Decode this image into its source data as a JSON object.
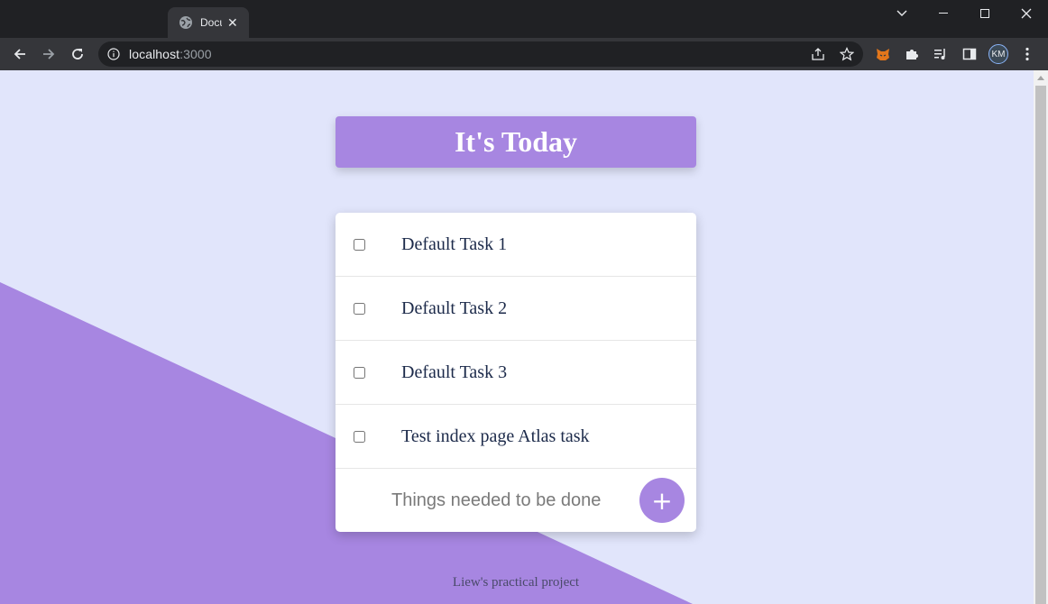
{
  "browser": {
    "tab_title": "Docu",
    "url_host": "localhost",
    "url_port": ":3000",
    "profile_initials": "KM"
  },
  "colors": {
    "accent": "#a786e1",
    "page_background": "#e1e5fb"
  },
  "icons": {
    "tab_favicon": "globe-icon",
    "back": "arrow-left-icon",
    "forward": "arrow-right-icon",
    "reload": "reload-icon",
    "site_info": "info-icon",
    "share": "share-icon",
    "bookmark": "star-icon",
    "extensions": "puzzle-icon",
    "media": "playlist-icon",
    "sidepanel": "sidepanel-icon",
    "menu": "kebab-menu-icon"
  },
  "page": {
    "title": "It's Today",
    "tasks": [
      {
        "label": "Default Task 1",
        "checked": false
      },
      {
        "label": "Default Task 2",
        "checked": false
      },
      {
        "label": "Default Task 3",
        "checked": false
      },
      {
        "label": "Test index page Atlas task",
        "checked": false
      }
    ],
    "input_placeholder": "Things needed to be done",
    "add_button_label": "+",
    "footer": "Liew's practical project"
  }
}
